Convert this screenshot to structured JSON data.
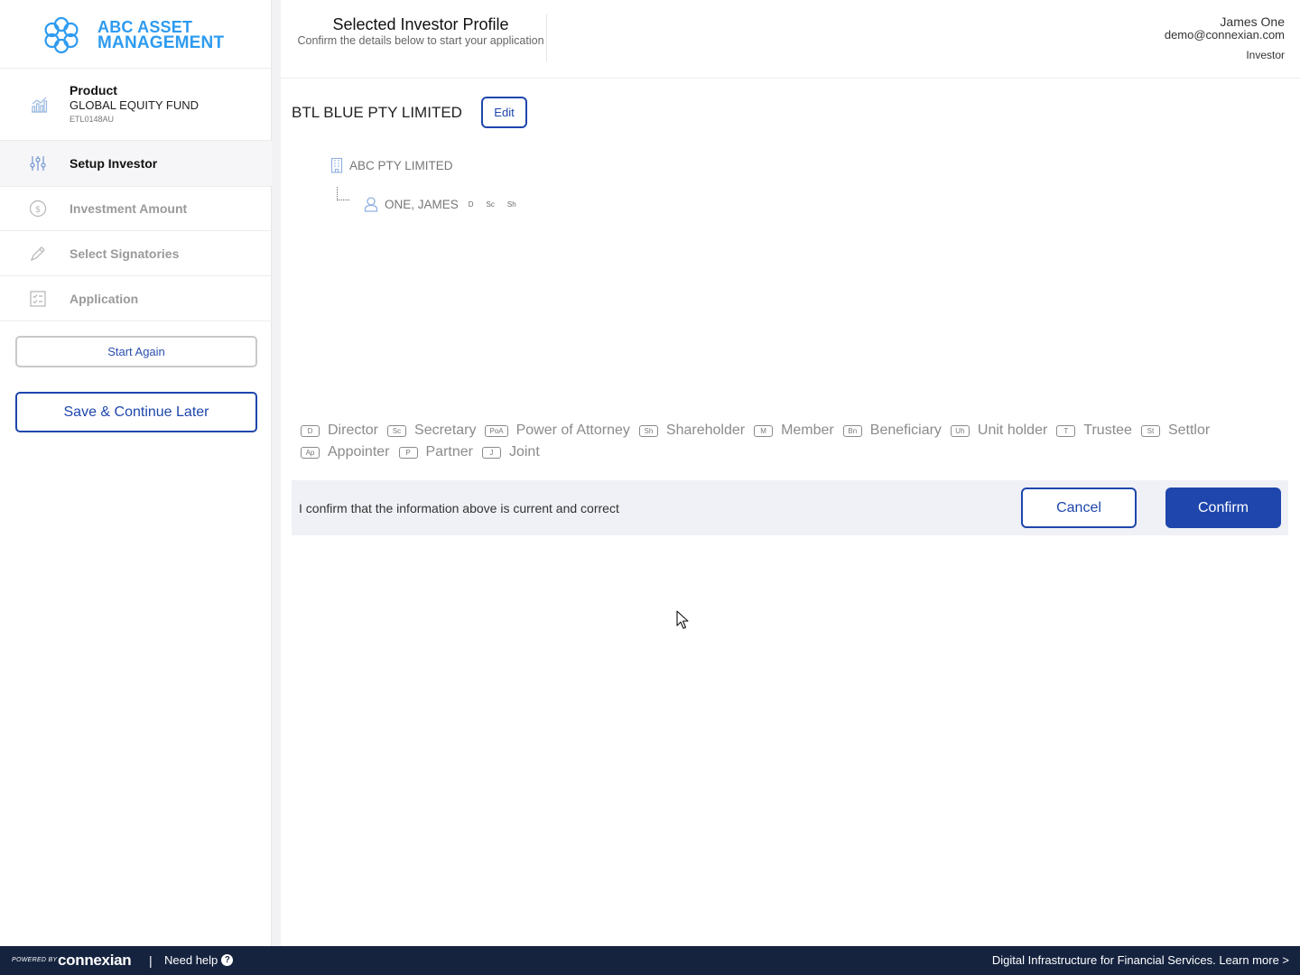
{
  "logo": {
    "line1": "ABC ASSET",
    "line2": "MANAGEMENT"
  },
  "product": {
    "label": "Product",
    "name": "GLOBAL EQUITY FUND",
    "code": "ETL0148AU"
  },
  "steps": [
    {
      "label": "Setup Investor",
      "icon": "sliders-icon",
      "active": true
    },
    {
      "label": "Investment Amount",
      "icon": "dollar-coin-icon",
      "active": false
    },
    {
      "label": "Select Signatories",
      "icon": "pen-icon",
      "active": false
    },
    {
      "label": "Application",
      "icon": "checklist-icon",
      "active": false
    }
  ],
  "buttons": {
    "start_again": "Start Again",
    "save_continue": "Save & Continue Later",
    "edit": "Edit",
    "cancel": "Cancel",
    "confirm": "Confirm"
  },
  "header": {
    "title": "Selected Investor Profile",
    "subtitle": "Confirm the details below to start your application",
    "user_name": "James One",
    "user_email": "demo@connexian.com",
    "user_role": "Investor"
  },
  "entity": {
    "name": "BTL BLUE PTY LIMITED",
    "company": "ABC PTY LIMITED",
    "person": "ONE, JAMES",
    "person_roles": [
      "D",
      "Sc",
      "Sh"
    ]
  },
  "legend": [
    {
      "code": "D",
      "label": "Director"
    },
    {
      "code": "Sc",
      "label": "Secretary"
    },
    {
      "code": "PoA",
      "label": "Power of Attorney"
    },
    {
      "code": "Sh",
      "label": "Shareholder"
    },
    {
      "code": "M",
      "label": "Member"
    },
    {
      "code": "Bn",
      "label": "Beneficiary"
    },
    {
      "code": "Uh",
      "label": "Unit holder"
    },
    {
      "code": "T",
      "label": "Trustee"
    },
    {
      "code": "St",
      "label": "Settlor"
    },
    {
      "code": "Ap",
      "label": "Appointer"
    },
    {
      "code": "P",
      "label": "Partner"
    },
    {
      "code": "J",
      "label": "Joint"
    }
  ],
  "confirm_statement": "I confirm that the information above is current and correct",
  "footer": {
    "powered_by": "POWERED BY",
    "brand": "connexian",
    "separator": "|",
    "help": "Need help",
    "tagline": "Digital Infrastructure for Financial Services. Learn more >"
  },
  "colors": {
    "primary": "#1e46ac",
    "logo": "#2d9bf0",
    "footer_bg": "#15233f",
    "confirm_bar_bg": "#f0f1f6"
  }
}
